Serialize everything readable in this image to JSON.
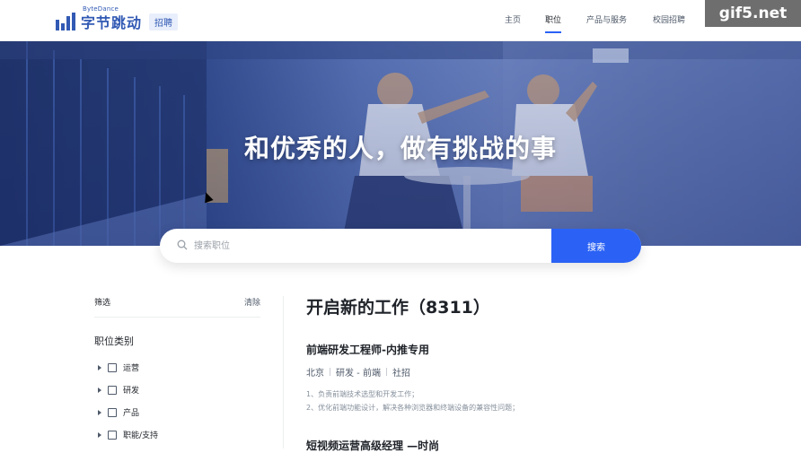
{
  "header": {
    "logo_small": "ByteDance",
    "logo_text": "字节跳动",
    "logo_badge": "招聘",
    "nav": [
      {
        "label": "主页",
        "active": false
      },
      {
        "label": "职位",
        "active": true
      },
      {
        "label": "产品与服务",
        "active": false
      },
      {
        "label": "校园招聘",
        "active": false
      }
    ],
    "brand_color": "#325ab4"
  },
  "watermark": "gif5.net",
  "hero": {
    "title": "和优秀的人，做有挑战的事"
  },
  "search": {
    "placeholder": "搜索职位",
    "value": "",
    "button_label": "搜索",
    "accent": "#2b62f5"
  },
  "filter": {
    "heading": "筛选",
    "clear_label": "清除",
    "category_title": "职位类别",
    "items": [
      {
        "label": "运营",
        "checked": false
      },
      {
        "label": "研发",
        "checked": false
      },
      {
        "label": "产品",
        "checked": false
      },
      {
        "label": "职能/支持",
        "checked": false
      }
    ]
  },
  "jobs": {
    "title": "开启新的工作（8311）",
    "list": [
      {
        "title": "前端研发工程师-内推专用",
        "location": "北京",
        "category": "研发 - 前端",
        "type": "社招",
        "desc": [
          "1、负责前端技术选型和开发工作；",
          "2、优化前端功能设计，解决各种浏览器和终端设备的兼容性问题；"
        ]
      },
      {
        "title": "短视频运营高级经理 —时尚"
      }
    ]
  }
}
